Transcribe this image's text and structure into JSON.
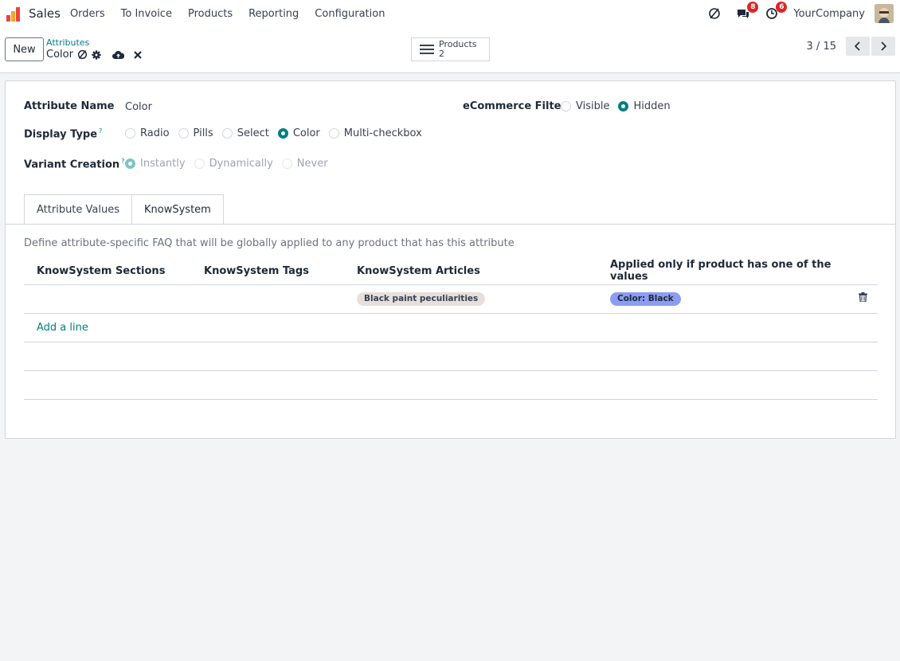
{
  "app": {
    "name": "Sales",
    "menu": [
      "Orders",
      "To Invoice",
      "Products",
      "Reporting",
      "Configuration"
    ],
    "company": "YourCompany",
    "badges": {
      "messages": "8",
      "activities": "6"
    },
    "colors": {
      "accent": "#017e84",
      "badge": "#dc2626"
    }
  },
  "control": {
    "new_label": "New",
    "breadcrumb_parent": "Attributes",
    "breadcrumb_current": "Color",
    "smart_button": {
      "label": "Products",
      "count": "2"
    },
    "pager": "3 / 15"
  },
  "form": {
    "attribute_name_label": "Attribute Name",
    "attribute_name_value": "Color",
    "ecommerce_label": "eCommerce Filter",
    "ecommerce_options": [
      "Visible",
      "Hidden"
    ],
    "ecommerce_selected": "Hidden",
    "display_type_label": "Display Type",
    "display_type_help": "?",
    "display_type_options": [
      "Radio",
      "Pills",
      "Select",
      "Color",
      "Multi-checkbox"
    ],
    "display_type_selected": "Color",
    "variant_label": "Variant Creation",
    "variant_help": "?",
    "variant_options": [
      "Instantly",
      "Dynamically",
      "Never"
    ],
    "variant_selected": "Instantly"
  },
  "tabs": [
    "Attribute Values",
    "KnowSystem"
  ],
  "active_tab": "KnowSystem",
  "knowsystem": {
    "help_text": "Define attribute-specific FAQ that will be globally applied to any product that has this attribute",
    "columns": [
      "KnowSystem Sections",
      "KnowSystem Tags",
      "KnowSystem Articles",
      "Applied only if product has one of the values"
    ],
    "rows": [
      {
        "sections": "",
        "tags": "",
        "article": "Black paint peculiarities",
        "values": "Color: Black"
      }
    ],
    "add_line": "Add a line"
  }
}
